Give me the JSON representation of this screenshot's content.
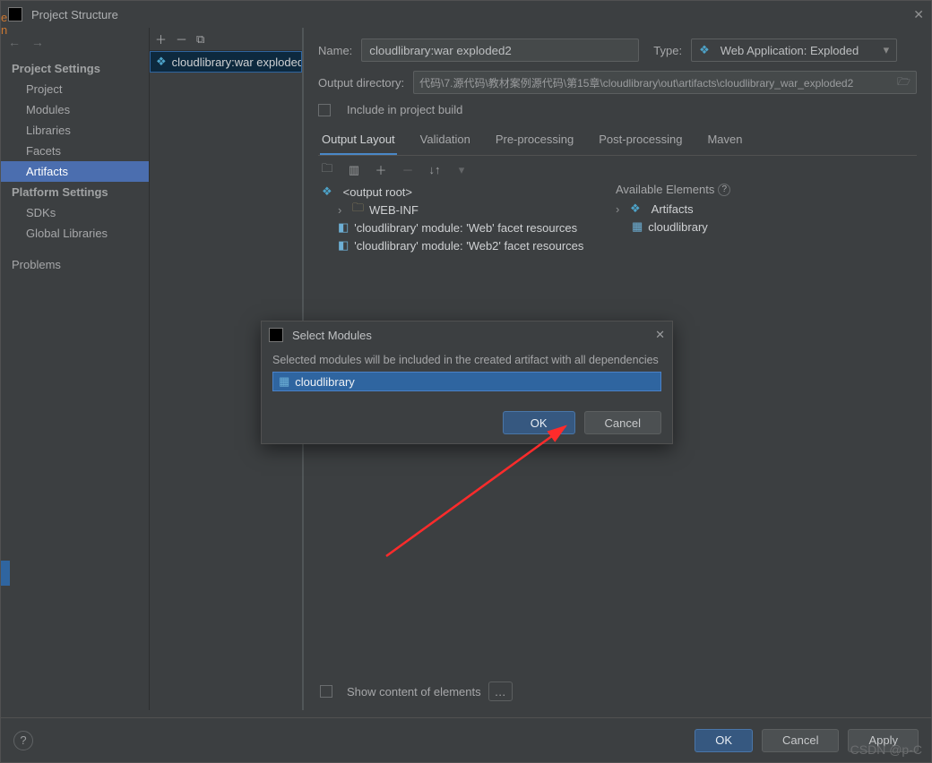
{
  "titlebar": {
    "title": "Project Structure"
  },
  "sidebar": {
    "section1_title": "Project Settings",
    "section2_title": "Platform Settings",
    "items": [
      "Project",
      "Modules",
      "Libraries",
      "Facets",
      "Artifacts"
    ],
    "platform_items": [
      "SDKs",
      "Global Libraries"
    ],
    "problems": "Problems"
  },
  "artifact_list": {
    "entry": "cloudlibrary:war exploded"
  },
  "main": {
    "name_label": "Name:",
    "name_value": "cloudlibrary:war exploded2",
    "type_label": "Type:",
    "type_value": "Web Application: Exploded",
    "outdir_label": "Output directory:",
    "outdir_value": "代码\\7.源代码\\教材案例源代码\\第15章\\cloudlibrary\\out\\artifacts\\cloudlibrary_war_exploded2",
    "include_label": "Include in project build",
    "tabs": [
      "Output Layout",
      "Validation",
      "Pre-processing",
      "Post-processing",
      "Maven"
    ],
    "tree": {
      "root": "<output root>",
      "webinf": "WEB-INF",
      "facet1": "'cloudlibrary' module: 'Web' facet resources",
      "facet2": "'cloudlibrary' module: 'Web2' facet resources"
    },
    "available": {
      "title": "Available Elements",
      "artifacts": "Artifacts",
      "module": "cloudlibrary"
    },
    "show_content": "Show content of elements"
  },
  "buttons": {
    "ok": "OK",
    "cancel": "Cancel",
    "apply": "Apply"
  },
  "modal": {
    "title": "Select Modules",
    "desc": "Selected modules will be included in the created artifact with all dependencies",
    "item": "cloudlibrary",
    "ok": "OK",
    "cancel": "Cancel"
  },
  "watermark": "CSDN @p-C",
  "edge_text": "e\nn"
}
